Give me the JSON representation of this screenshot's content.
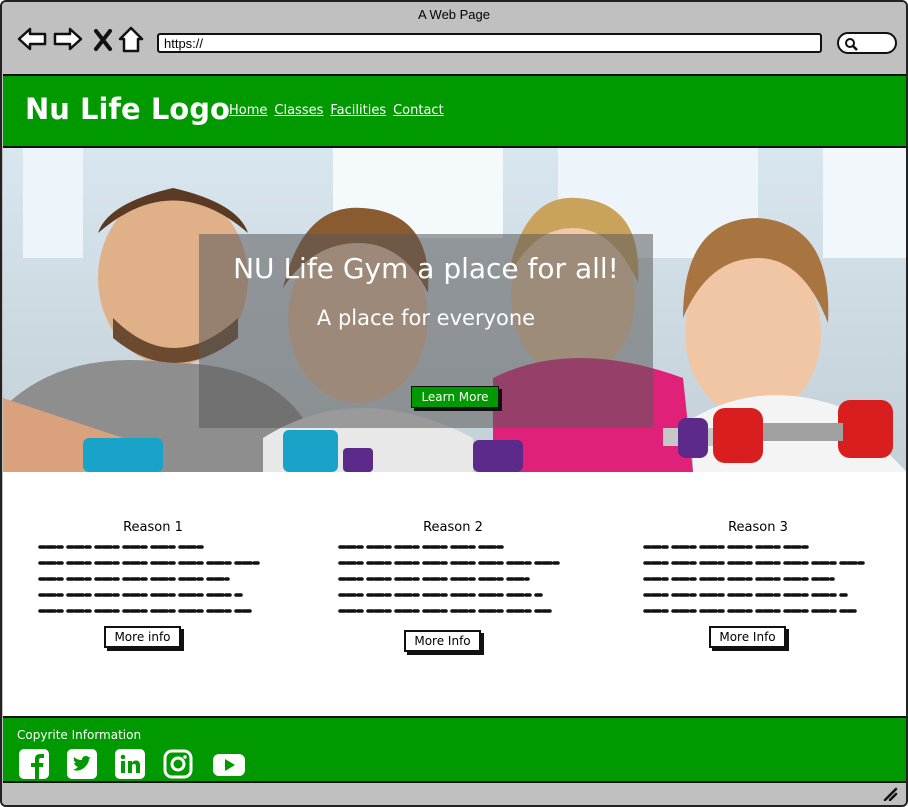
{
  "window": {
    "title": "A Web Page"
  },
  "address_bar": {
    "url": "https://"
  },
  "header": {
    "logo": "Nu Life Logo",
    "nav": [
      "Home",
      "Classes",
      "Facilities",
      "Contact"
    ]
  },
  "hero": {
    "title": "NU Life Gym a place for all!",
    "subtitle": "A place for everyone",
    "button": "Learn More"
  },
  "reasons": [
    {
      "title": "Reason 1",
      "button": "More info"
    },
    {
      "title": "Reason 2",
      "button": "More Info"
    },
    {
      "title": "Reason 3",
      "button": "More Info"
    }
  ],
  "footer": {
    "text": "Copyrite Information",
    "social_icons": [
      "facebook-icon",
      "twitter-icon",
      "linkedin-icon",
      "instagram-icon",
      "youtube-icon"
    ]
  },
  "colors": {
    "brand": "#009900",
    "chrome": "#c0c0c0"
  }
}
